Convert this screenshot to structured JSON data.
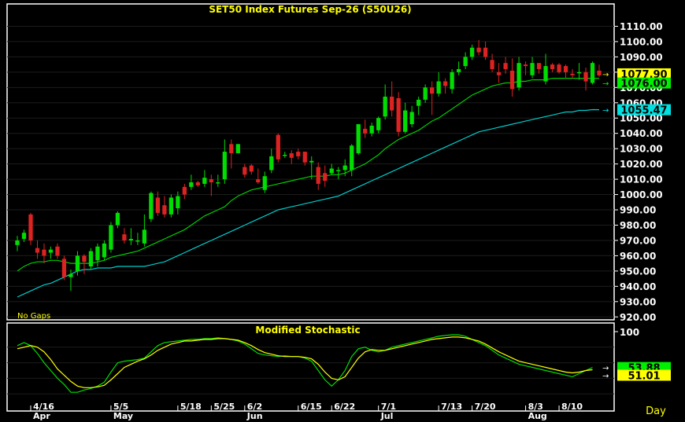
{
  "chart_data": [
    {
      "type": "candlestick",
      "title": "SET50  Index  Futures  Sep-26  (S50U26)",
      "note": "No  Gaps",
      "ylim": [
        915,
        1120
      ],
      "y_ticks": [
        "920.00",
        "930.00",
        "940.00",
        "950.00",
        "960.00",
        "970.00",
        "980.00",
        "990.00",
        "1000.00",
        "1010.00",
        "1020.00",
        "1030.00",
        "1040.00",
        "1050.00",
        "1060.00",
        "1070.00",
        "1080.00",
        "1090.00",
        "1100.00",
        "1110.00"
      ],
      "x_labels": [
        {
          "label": "4/16",
          "bar": 2
        },
        {
          "label": "Apr",
          "bar": 2
        },
        {
          "label": "5/5",
          "bar": 14
        },
        {
          "label": "May",
          "bar": 14
        },
        {
          "label": "5/18",
          "bar": 24
        },
        {
          "label": "5/25",
          "bar": 29
        },
        {
          "label": "6/2",
          "bar": 34
        },
        {
          "label": "Jun",
          "bar": 34
        },
        {
          "label": "6/15",
          "bar": 42
        },
        {
          "label": "6/22",
          "bar": 47
        },
        {
          "label": "7/1",
          "bar": 54
        },
        {
          "label": "Jul",
          "bar": 54
        },
        {
          "label": "7/13",
          "bar": 63
        },
        {
          "label": "7/20",
          "bar": 68
        },
        {
          "label": "8/3",
          "bar": 76
        },
        {
          "label": "Aug",
          "bar": 76
        },
        {
          "label": "8/10",
          "bar": 81
        }
      ],
      "candles": [
        {
          "o": 967,
          "h": 973,
          "l": 963,
          "c": 970
        },
        {
          "o": 971,
          "h": 977,
          "l": 969,
          "c": 975
        },
        {
          "o": 987,
          "h": 988,
          "l": 967,
          "c": 970
        },
        {
          "o": 965,
          "h": 970,
          "l": 958,
          "c": 962
        },
        {
          "o": 964,
          "h": 968,
          "l": 955,
          "c": 960
        },
        {
          "o": 962,
          "h": 966,
          "l": 958,
          "c": 964
        },
        {
          "o": 966,
          "h": 968,
          "l": 958,
          "c": 960
        },
        {
          "o": 958,
          "h": 960,
          "l": 944,
          "c": 946
        },
        {
          "o": 946,
          "h": 951,
          "l": 937,
          "c": 948
        },
        {
          "o": 950,
          "h": 963,
          "l": 947,
          "c": 960
        },
        {
          "o": 960,
          "h": 961,
          "l": 948,
          "c": 956
        },
        {
          "o": 953,
          "h": 965,
          "l": 951,
          "c": 963
        },
        {
          "o": 957,
          "h": 968,
          "l": 953,
          "c": 966
        },
        {
          "o": 959,
          "h": 970,
          "l": 957,
          "c": 968
        },
        {
          "o": 964,
          "h": 982,
          "l": 962,
          "c": 980
        },
        {
          "o": 980,
          "h": 989,
          "l": 978,
          "c": 988
        },
        {
          "o": 974,
          "h": 978,
          "l": 968,
          "c": 970
        },
        {
          "o": 970,
          "h": 978,
          "l": 967,
          "c": 971
        },
        {
          "o": 970,
          "h": 975,
          "l": 967,
          "c": 970
        },
        {
          "o": 968,
          "h": 987,
          "l": 966,
          "c": 977
        },
        {
          "o": 984,
          "h": 1002,
          "l": 982,
          "c": 1001
        },
        {
          "o": 998,
          "h": 1002,
          "l": 986,
          "c": 988
        },
        {
          "o": 993,
          "h": 999,
          "l": 985,
          "c": 987
        },
        {
          "o": 987,
          "h": 1000,
          "l": 985,
          "c": 998
        },
        {
          "o": 991,
          "h": 1002,
          "l": 987,
          "c": 999
        },
        {
          "o": 1005,
          "h": 1007,
          "l": 997,
          "c": 1000
        },
        {
          "o": 1005,
          "h": 1013,
          "l": 1003,
          "c": 1008
        },
        {
          "o": 1008,
          "h": 1009,
          "l": 1005,
          "c": 1006
        },
        {
          "o": 1007,
          "h": 1016,
          "l": 1005,
          "c": 1011
        },
        {
          "o": 1010,
          "h": 1013,
          "l": 999,
          "c": 1008
        },
        {
          "o": 1008,
          "h": 1013,
          "l": 1005,
          "c": 1008
        },
        {
          "o": 1010,
          "h": 1036,
          "l": 1007,
          "c": 1028
        },
        {
          "o": 1033,
          "h": 1036,
          "l": 1017,
          "c": 1027
        },
        {
          "o": 1027,
          "h": 1033,
          "l": 1027,
          "c": 1033
        },
        {
          "o": 1018,
          "h": 1020,
          "l": 1011,
          "c": 1013
        },
        {
          "o": 1019,
          "h": 1020,
          "l": 1013,
          "c": 1015
        },
        {
          "o": 1010,
          "h": 1017,
          "l": 1007,
          "c": 1008
        },
        {
          "o": 1003,
          "h": 1015,
          "l": 1001,
          "c": 1012
        },
        {
          "o": 1016,
          "h": 1030,
          "l": 1014,
          "c": 1025
        },
        {
          "o": 1039,
          "h": 1040,
          "l": 1021,
          "c": 1023
        },
        {
          "o": 1026,
          "h": 1028,
          "l": 1024,
          "c": 1026
        },
        {
          "o": 1027,
          "h": 1029,
          "l": 1020,
          "c": 1024
        },
        {
          "o": 1028,
          "h": 1030,
          "l": 1023,
          "c": 1025
        },
        {
          "o": 1028,
          "h": 1028,
          "l": 1019,
          "c": 1021
        },
        {
          "o": 1021,
          "h": 1025,
          "l": 1010,
          "c": 1022
        },
        {
          "o": 1018,
          "h": 1021,
          "l": 1003,
          "c": 1007
        },
        {
          "o": 1014,
          "h": 1019,
          "l": 1005,
          "c": 1009
        },
        {
          "o": 1014,
          "h": 1020,
          "l": 1013,
          "c": 1017
        },
        {
          "o": 1016,
          "h": 1018,
          "l": 1010,
          "c": 1016
        },
        {
          "o": 1016,
          "h": 1023,
          "l": 1012,
          "c": 1019
        },
        {
          "o": 1016,
          "h": 1033,
          "l": 1012,
          "c": 1032
        },
        {
          "o": 1027,
          "h": 1046,
          "l": 1026,
          "c": 1046
        },
        {
          "o": 1043,
          "h": 1049,
          "l": 1037,
          "c": 1040
        },
        {
          "o": 1040,
          "h": 1047,
          "l": 1038,
          "c": 1045
        },
        {
          "o": 1042,
          "h": 1051,
          "l": 1040,
          "c": 1050
        },
        {
          "o": 1051,
          "h": 1072,
          "l": 1049,
          "c": 1064
        },
        {
          "o": 1064,
          "h": 1074,
          "l": 1051,
          "c": 1055
        },
        {
          "o": 1063,
          "h": 1067,
          "l": 1038,
          "c": 1041
        },
        {
          "o": 1041,
          "h": 1060,
          "l": 1040,
          "c": 1055
        },
        {
          "o": 1046,
          "h": 1058,
          "l": 1044,
          "c": 1054
        },
        {
          "o": 1058,
          "h": 1064,
          "l": 1052,
          "c": 1062
        },
        {
          "o": 1062,
          "h": 1072,
          "l": 1060,
          "c": 1070
        },
        {
          "o": 1070,
          "h": 1074,
          "l": 1052,
          "c": 1066
        },
        {
          "o": 1066,
          "h": 1080,
          "l": 1064,
          "c": 1074
        },
        {
          "o": 1074,
          "h": 1076,
          "l": 1066,
          "c": 1071
        },
        {
          "o": 1069,
          "h": 1082,
          "l": 1066,
          "c": 1080
        },
        {
          "o": 1080,
          "h": 1087,
          "l": 1078,
          "c": 1082
        },
        {
          "o": 1084,
          "h": 1093,
          "l": 1082,
          "c": 1090
        },
        {
          "o": 1090,
          "h": 1098,
          "l": 1088,
          "c": 1096
        },
        {
          "o": 1096,
          "h": 1101,
          "l": 1091,
          "c": 1093
        },
        {
          "o": 1096,
          "h": 1100,
          "l": 1088,
          "c": 1090
        },
        {
          "o": 1088,
          "h": 1092,
          "l": 1080,
          "c": 1082
        },
        {
          "o": 1080,
          "h": 1086,
          "l": 1073,
          "c": 1078
        },
        {
          "o": 1086,
          "h": 1090,
          "l": 1079,
          "c": 1082
        },
        {
          "o": 1081,
          "h": 1089,
          "l": 1064,
          "c": 1069
        },
        {
          "o": 1070,
          "h": 1090,
          "l": 1068,
          "c": 1086
        },
        {
          "o": 1085,
          "h": 1087,
          "l": 1078,
          "c": 1084
        },
        {
          "o": 1078,
          "h": 1090,
          "l": 1076,
          "c": 1086
        },
        {
          "o": 1086,
          "h": 1086,
          "l": 1079,
          "c": 1082
        },
        {
          "o": 1074,
          "h": 1092,
          "l": 1072,
          "c": 1084
        },
        {
          "o": 1085,
          "h": 1086,
          "l": 1080,
          "c": 1082
        },
        {
          "o": 1085,
          "h": 1086,
          "l": 1079,
          "c": 1080
        },
        {
          "o": 1084,
          "h": 1085,
          "l": 1076,
          "c": 1080
        },
        {
          "o": 1079,
          "h": 1082,
          "l": 1076,
          "c": 1078
        },
        {
          "o": 1080,
          "h": 1086,
          "l": 1075,
          "c": 1080
        },
        {
          "o": 1080,
          "h": 1083,
          "l": 1068,
          "c": 1074
        },
        {
          "o": 1073,
          "h": 1087,
          "l": 1072,
          "c": 1086
        },
        {
          "o": 1081,
          "h": 1085,
          "l": 1077,
          "c": 1077.9
        }
      ],
      "ma_fast": [
        950,
        953,
        955,
        956,
        956,
        957,
        957,
        956,
        955,
        955,
        955,
        955,
        956,
        957,
        959,
        960,
        961,
        962,
        963,
        965,
        967,
        969,
        971,
        973,
        975,
        977,
        980,
        983,
        986,
        988,
        990,
        992,
        996,
        999,
        1001,
        1003,
        1004,
        1005,
        1006,
        1007,
        1008,
        1009,
        1010,
        1011,
        1012,
        1012,
        1012,
        1013,
        1013,
        1014,
        1016,
        1018,
        1020,
        1023,
        1026,
        1030,
        1033,
        1036,
        1038,
        1040,
        1042,
        1045,
        1048,
        1050,
        1053,
        1056,
        1059,
        1062,
        1065,
        1067,
        1069,
        1071,
        1072,
        1073,
        1073,
        1074,
        1074,
        1075,
        1075,
        1075,
        1076,
        1076,
        1076,
        1076,
        1076,
        1076,
        1076,
        1076
      ],
      "ma_slow": [
        933,
        935,
        937,
        939,
        941,
        942,
        944,
        946,
        948,
        950,
        951,
        951,
        952,
        952,
        952,
        953,
        953,
        953,
        953,
        953,
        954,
        955,
        956,
        958,
        960,
        962,
        964,
        966,
        968,
        970,
        972,
        974,
        976,
        978,
        980,
        982,
        984,
        986,
        988,
        990,
        991,
        992,
        993,
        994,
        995,
        996,
        997,
        998,
        999,
        1001,
        1003,
        1005,
        1007,
        1009,
        1011,
        1013,
        1015,
        1017,
        1019,
        1021,
        1023,
        1025,
        1027,
        1029,
        1031,
        1033,
        1035,
        1037,
        1039,
        1041,
        1042,
        1043,
        1044,
        1045,
        1046,
        1047,
        1048,
        1049,
        1050,
        1051,
        1052,
        1053,
        1054,
        1054,
        1055,
        1055,
        1055.5,
        1055.47
      ],
      "labels": {
        "close": "1077.90",
        "ma_fast": "1076.00",
        "ma_slow": "1055.47"
      },
      "colors": {
        "up": "#00dd00",
        "down": "#dd2222",
        "ma_fast": "#00cc00",
        "ma_slow": "#00cccc",
        "background": "#000000",
        "frame": "#ffffff",
        "title": "#ffff00"
      }
    },
    {
      "type": "line",
      "title": "Modified  Stochastic",
      "ylim": [
        0,
        100
      ],
      "y_ticks": [
        "100"
      ],
      "series": [
        {
          "color": "#00dd00",
          "values": [
            82,
            86,
            82,
            72,
            60,
            50,
            40,
            32,
            22,
            22,
            25,
            27,
            30,
            35,
            48,
            60,
            62,
            63,
            64,
            66,
            74,
            82,
            86,
            87,
            88,
            89,
            90,
            90,
            91,
            91,
            92,
            91,
            90,
            88,
            84,
            78,
            72,
            70,
            69,
            68,
            69,
            68,
            68,
            66,
            62,
            50,
            38,
            30,
            38,
            50,
            68,
            78,
            80,
            76,
            74,
            76,
            80,
            82,
            84,
            86,
            88,
            90,
            92,
            94,
            95,
            96,
            96,
            94,
            90,
            86,
            82,
            76,
            70,
            66,
            62,
            58,
            56,
            54,
            52,
            50,
            48,
            46,
            44,
            42,
            46,
            50,
            53.88
          ]
        },
        {
          "color": "#ffff00",
          "values": [
            78,
            80,
            82,
            80,
            74,
            64,
            52,
            44,
            36,
            30,
            28,
            28,
            29,
            31,
            38,
            46,
            54,
            58,
            62,
            65,
            70,
            76,
            80,
            84,
            86,
            88,
            88,
            89,
            90,
            90,
            91,
            91,
            90,
            89,
            86,
            82,
            77,
            73,
            71,
            69,
            68,
            68,
            68,
            67,
            65,
            58,
            48,
            40,
            38,
            42,
            54,
            66,
            74,
            77,
            76,
            76,
            78,
            80,
            82,
            84,
            86,
            88,
            90,
            91,
            92,
            93,
            93,
            92,
            90,
            88,
            84,
            79,
            74,
            70,
            66,
            62,
            60,
            58,
            56,
            54,
            52,
            50,
            48,
            47,
            48,
            50,
            51.01
          ]
        }
      ],
      "labels": {
        "k": "53.88",
        "d": "51.01"
      }
    }
  ],
  "x_axis_unit": "Day"
}
